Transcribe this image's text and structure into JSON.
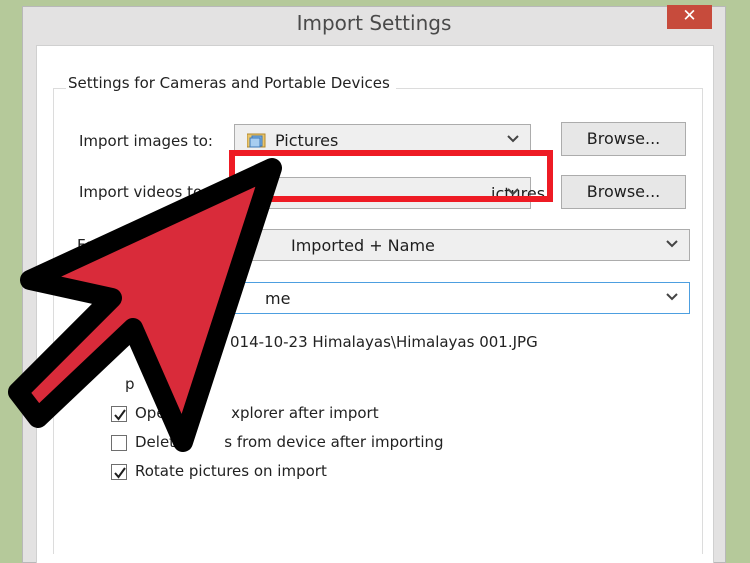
{
  "window": {
    "title": "Import Settings",
    "close_symbol": "✕"
  },
  "group": {
    "label": "Settings for Cameras and Portable Devices"
  },
  "import_images": {
    "label": "Import images to:",
    "value": "Pictures",
    "browse_label": "Browse..."
  },
  "import_videos": {
    "label": "Import videos to:",
    "value": "ictures",
    "browse_label": "Browse..."
  },
  "folder_name": {
    "label": "Fol",
    "value": "Imported + Name"
  },
  "file_name": {
    "value": "me"
  },
  "example": {
    "label": "E",
    "value": "014-10-23 Himalayas\\Himalayas 001.JPG"
  },
  "options": {
    "label": "p",
    "items": [
      {
        "label": "Open",
        "label_tail": "xplorer after import",
        "checked": true
      },
      {
        "label": "Delete",
        "label_tail": "s from device after importing",
        "checked": false
      },
      {
        "label": "Rotate pictures on import",
        "label_tail": "",
        "checked": true
      }
    ]
  },
  "colors": {
    "highlight_box": "#ee1b24",
    "arrow_fill": "#d92b3a",
    "arrow_outline": "#000000",
    "close_button": "#c74b3c",
    "background": "#b5c99a"
  },
  "icons": {
    "folder": "folder-pictures-icon",
    "dropdown": "chevron-down-icon",
    "check": "checkmark-icon",
    "pointer": "arrow-pointer-icon"
  }
}
